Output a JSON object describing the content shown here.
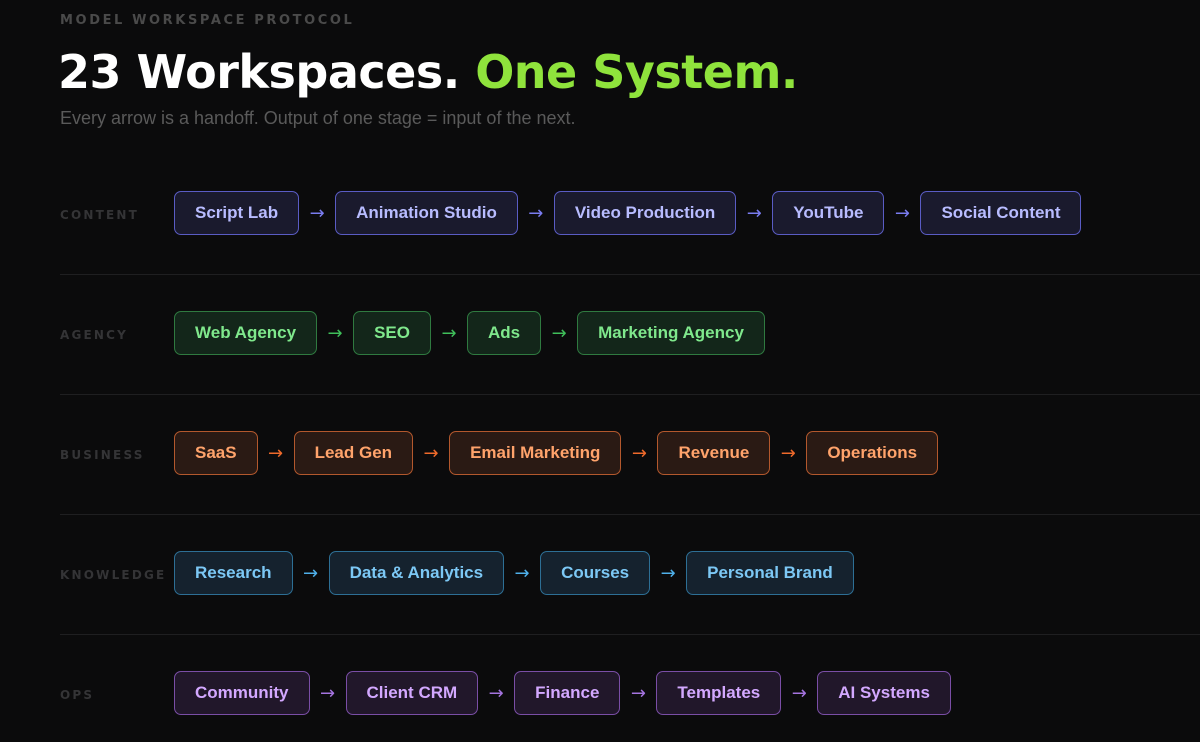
{
  "header": {
    "eyebrow": "MODEL WORKSPACE PROTOCOL",
    "title_main": "23 Workspaces.",
    "title_accent": "One System.",
    "subtitle": "Every arrow is a handoff. Output of one stage = input of the next."
  },
  "arrow_glyph": "→",
  "colors": {
    "accent": "#8fe33c",
    "content": "#7a7cf0",
    "agency": "#3fbf5a",
    "business": "#ef6a2b",
    "knowledge": "#4fb0ea",
    "ops": "#a574e0"
  },
  "lanes": [
    {
      "label": "CONTENT",
      "nodes": [
        "Script Lab",
        "Animation Studio",
        "Video Production",
        "YouTube",
        "Social Content"
      ]
    },
    {
      "label": "AGENCY",
      "nodes": [
        "Web Agency",
        "SEO",
        "Ads",
        "Marketing Agency"
      ]
    },
    {
      "label": "BUSINESS",
      "nodes": [
        "SaaS",
        "Lead Gen",
        "Email Marketing",
        "Revenue",
        "Operations"
      ]
    },
    {
      "label": "KNOWLEDGE",
      "nodes": [
        "Research",
        "Data & Analytics",
        "Courses",
        "Personal Brand"
      ]
    },
    {
      "label": "OPS",
      "nodes": [
        "Community",
        "Client CRM",
        "Finance",
        "Templates",
        "AI Systems"
      ]
    }
  ]
}
